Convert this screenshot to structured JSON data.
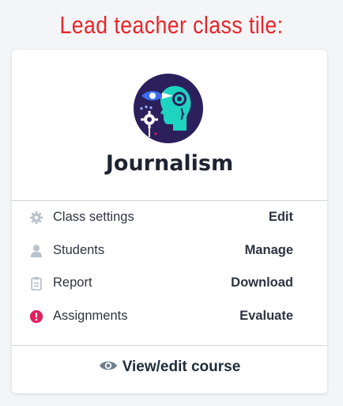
{
  "caption": "Lead teacher class tile:",
  "class_tile": {
    "title": "Journalism",
    "avatar_icon": "journalism-illustration-icon",
    "rows": [
      {
        "icon": "gear-icon",
        "label": "Class settings",
        "action": "Edit",
        "icon_color": "#b9c3ce"
      },
      {
        "icon": "user-icon",
        "label": "Students",
        "action": "Manage",
        "icon_color": "#b9c3ce"
      },
      {
        "icon": "clipboard-icon",
        "label": "Report",
        "action": "Download",
        "icon_color": "#b9c3ce"
      },
      {
        "icon": "alert-icon",
        "label": "Assignments",
        "action": "Evaluate",
        "icon_color": "#e0215f"
      }
    ],
    "footer_link": {
      "icon": "eye-icon",
      "label": "View/edit course"
    }
  },
  "colors": {
    "caption": "#e8262b",
    "avatar_bg": "#2b1f5c",
    "avatar_accent": "#1ed3c0",
    "text": "#2e3440"
  }
}
